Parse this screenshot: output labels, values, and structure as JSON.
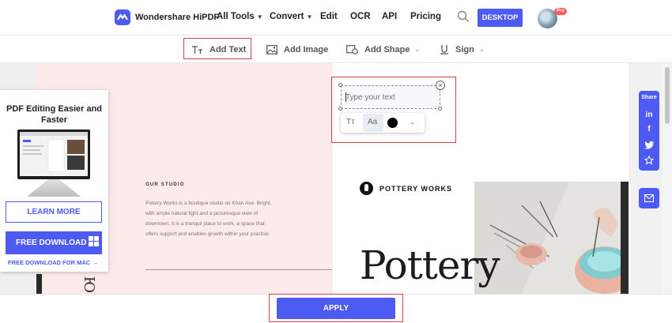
{
  "header": {
    "logo_text": "Wondershare HiPDF",
    "nav": {
      "all_tools": "All Tools",
      "convert": "Convert",
      "edit": "Edit",
      "ocr": "OCR",
      "api": "API",
      "pricing": "Pricing"
    },
    "desktop_label": "DESKTOP",
    "pro_badge": "Pro"
  },
  "toolbar": {
    "add_text": "Add Text",
    "add_image": "Add Image",
    "add_shape": "Add Shape",
    "sign": "Sign",
    "active_tool": "Add Text"
  },
  "text_editor": {
    "placeholder": "Type your text",
    "font_size_icon": "Tт",
    "font_family_icon": "Aa",
    "text_color": "#000000"
  },
  "document": {
    "studio_heading": "OUR STUDIO",
    "studio_body": "Pottery Works is a boutique studio on Khan Ave. Bright, with ample natural light and a picturesque view of downtown. It is a tranquil place to work, a space that offers support and enables growth within your practise.",
    "brand_name": "POTTERY WORKS",
    "big_title": "Pottery",
    "side_text": "Ю"
  },
  "promo": {
    "title": "PDF Editing Easier and Faster",
    "learn_more": "LEARN MORE",
    "free_download": "FREE DOWNLOAD",
    "mac_link": "FREE DOWNLOAD FOR MAC →"
  },
  "share": {
    "label": "Share",
    "linkedin": "in",
    "facebook": "f"
  },
  "apply_label": "APPLY",
  "colors": {
    "accent": "#4d5bf2",
    "highlight": "#d8404c",
    "page_pink": "#fcebea"
  }
}
